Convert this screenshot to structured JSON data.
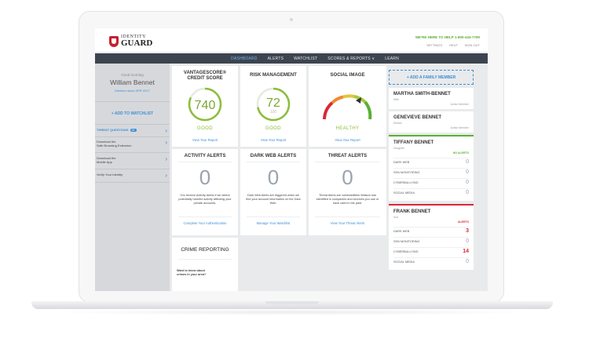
{
  "brand": {
    "logo_top": "IDENTITY",
    "logo_bottom": "GUARD"
  },
  "header": {
    "help_line": "WE'RE HERE TO HELP 1-800-443-7790",
    "links": [
      "SETTINGS",
      "HELP",
      "SIGN OUT"
    ]
  },
  "nav": {
    "items": [
      "DASHBOARD",
      "ALERTS",
      "WATCHLIST",
      "SCORES & REPORTS ∨",
      "LEARN"
    ],
    "active": "DASHBOARD"
  },
  "sidebar": {
    "greeting": "Good morning",
    "name": "William Bennet",
    "member_since": "Member since APR 2017",
    "add_watchlist": "+ ADD TO WATCHLIST",
    "threat_questions": "THREAT QUESTIONS",
    "threat_badge": "14",
    "items": [
      {
        "label": "Download the\nSafe Browsing Extension"
      },
      {
        "label": "Download the\nMobile App"
      },
      {
        "label": "Verify Your Identity"
      }
    ]
  },
  "scores": {
    "vantage": {
      "title": "VANTAGESCORE®\nCREDIT SCORE",
      "value": "740",
      "rating": "GOOD",
      "link": "View Your Report",
      "fraction": 0.82
    },
    "risk": {
      "title": "RISK MANAGEMENT",
      "value": "72",
      "max": "100",
      "rating": "GOOD",
      "link": "View Your Report",
      "fraction": 0.72
    },
    "social": {
      "title": "SOCIAL IMAGE",
      "rating": "HEALTHY",
      "link": "View Your Report"
    }
  },
  "alerts": {
    "activity": {
      "title": "ACTIVITY ALERTS",
      "count": "0",
      "desc": "You receive Activity Alerts if we detect potentially harmful activity affecting your private accounts.",
      "link": "Complete Your Authentication"
    },
    "dark_web": {
      "title": "DARK WEB ALERTS",
      "count": "0",
      "desc": "Dark Web Alerts are triggered when we find your account information on the Dark Web.",
      "link": "Manage Your Watchlist"
    },
    "threat": {
      "title": "THREAT ALERTS",
      "count": "0",
      "desc": "Threat Alerts are vulnerabilities Watson has identified in companies and services you use or have used in the past.",
      "link": "View Your Threat Alerts"
    }
  },
  "crime": {
    "title": "CRIME REPORTING",
    "desc": "Want to know about\ncrimes in your area?"
  },
  "family": {
    "add_label": "+ ADD A FAMILY MEMBER",
    "members": [
      {
        "name": "MARTHA SMITH-BENNET",
        "role": "Wife",
        "status": "Active Member"
      },
      {
        "name": "GENEVIEVE BENNET",
        "role": "Mother",
        "status": "Active Member"
      }
    ],
    "tiffany": {
      "name": "TIFFANY BENNET",
      "role": "Daughter",
      "status": "NO ALERTS",
      "rows": [
        {
          "label": "DARK WEB",
          "value": "0"
        },
        {
          "label": "SSN MONITORING",
          "value": "0"
        },
        {
          "label": "CYBERBULLYING",
          "value": "0"
        },
        {
          "label": "SOCIAL MEDIA",
          "value": "0"
        }
      ]
    },
    "frank": {
      "name": "FRANK BENNET",
      "role": "Son",
      "status": "ALERTS",
      "rows": [
        {
          "label": "DARK WEB",
          "value": "3"
        },
        {
          "label": "SSN MONITORING",
          "value": "0"
        },
        {
          "label": "CYBERBULLYING",
          "value": "14"
        },
        {
          "label": "SOCIAL MEDIA",
          "value": "0"
        }
      ]
    }
  },
  "colors": {
    "accent": "#3d8fd4",
    "good": "#8cbd3a",
    "alert": "#d8293a",
    "nav_bg": "#3d4450"
  }
}
